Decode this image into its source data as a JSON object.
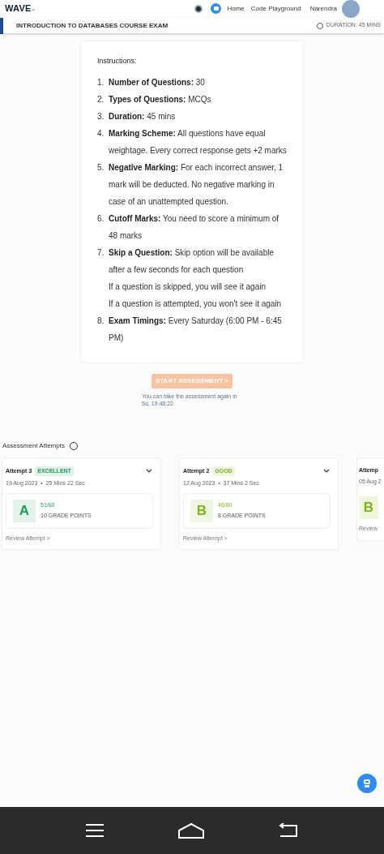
{
  "header": {
    "logo": "WAVE",
    "logo_mark": "™",
    "nav": [
      "Home",
      "Code Playground"
    ],
    "user": "Narendra"
  },
  "exam_bar": {
    "title": "INTRODUCTION TO DATABASES COURSE EXAM",
    "duration": "DURATION: 45 MINS"
  },
  "instructions": {
    "heading": "Instructions:",
    "items": [
      {
        "number": "1.",
        "text": "**Number of Questions:** 30"
      },
      {
        "number": "2.",
        "text": "**Types of Questions:** MCQs"
      },
      {
        "number": "3.",
        "text": "**Duration:** 45 mins"
      },
      {
        "number": "4.",
        "text": "**Marking Scheme:** All questions have equal weightage. Every correct response gets +2 marks"
      },
      {
        "number": "5.",
        "text": "**Negative Marking:** For each incorrect answer, 1 mark will be deducted. No negative marking in case of an unattempted question."
      },
      {
        "number": "6.",
        "text": "**Cutoff Marks:** You need to score a minimum of 48 marks"
      },
      {
        "number": "7.",
        "text": "**Skip a Question:** Skip option will be available after a few seconds for each question",
        "notes": [
          "If a question is skipped, you will see it again",
          "If a question is attempted, you won't see it again"
        ]
      },
      {
        "number": "8.",
        "text": "**Exam Timings:** Every Saturday (6:00 PM - 6:45 PM)"
      }
    ]
  },
  "start_button": {
    "label": "START ASSESSMENT >",
    "disabled": true
  },
  "retake_note": "You can take the assessment again in 5d, 19:48:22",
  "attempts": {
    "heading": "Assessment Attempts",
    "cards": [
      {
        "title": "Attempt 3",
        "badge": "EXCELLENT",
        "color": "#1f9d55",
        "meta": "19 Aug 2023  •  25 Mins 22 Sec",
        "grade": "A",
        "score": "51/60",
        "points": "10 GRADE POINTS",
        "link": "Review Attempt >"
      },
      {
        "title": "Attempt 2",
        "badge": "GOOD",
        "color": "#7cb518",
        "meta": "12 Aug 2023  •  37 Mins 2 Sec",
        "grade": "B",
        "score": "46/60",
        "points": "8 GRADE POINTS",
        "link": "Review Attempt >"
      }
    ],
    "partial_card": {
      "title": "Attemp",
      "meta": "05 Aug 2",
      "grade": "B",
      "link": "Review"
    }
  }
}
